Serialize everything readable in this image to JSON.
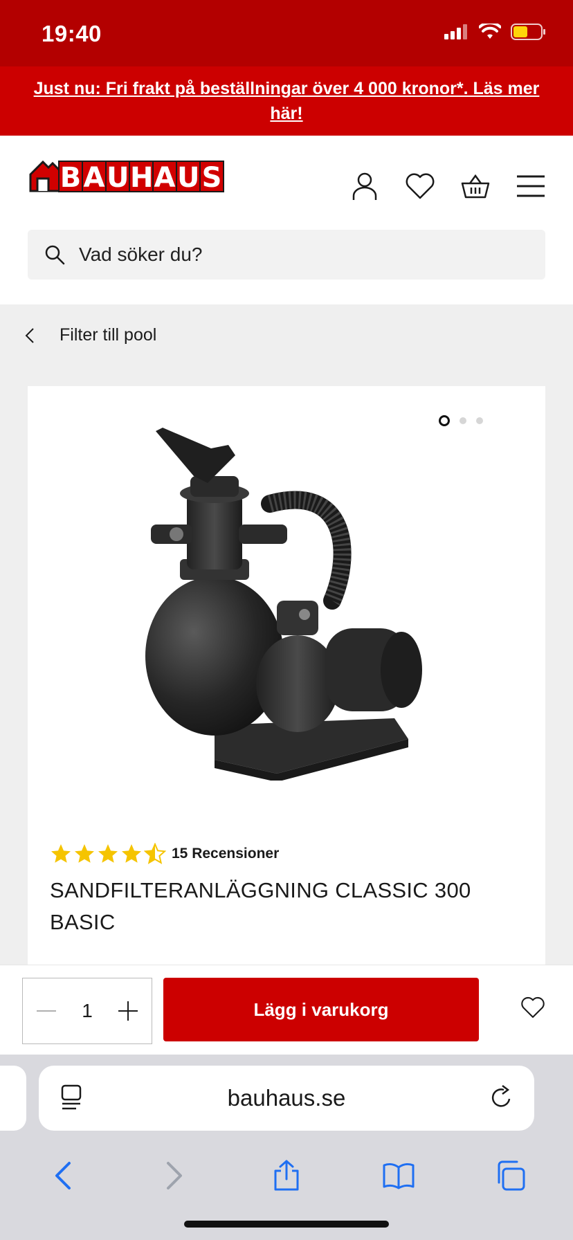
{
  "status_bar": {
    "time": "19:40"
  },
  "promo": {
    "text": "Just nu: Fri frakt på beställningar över 4 000 kronor*. Läs mer här!"
  },
  "header": {
    "logo_text": "BAUHAUS",
    "icons": [
      "user-icon",
      "heart-icon",
      "basket-icon",
      "menu-icon"
    ],
    "accent_color": "#cc0000"
  },
  "search": {
    "placeholder": "Vad söker du?"
  },
  "breadcrumb": {
    "label": "Filter till pool"
  },
  "product": {
    "rating": 4.5,
    "rating_max": 5,
    "reviews_label": "15 Recensioner",
    "title": "SANDFILTERANLÄGGNING CLASSIC 300 BASIC",
    "image_count": 3,
    "active_image": 1
  },
  "buy_bar": {
    "quantity": "1",
    "add_to_cart_label": "Lägg i varukorg"
  },
  "browser": {
    "url": "bauhaus.se"
  }
}
